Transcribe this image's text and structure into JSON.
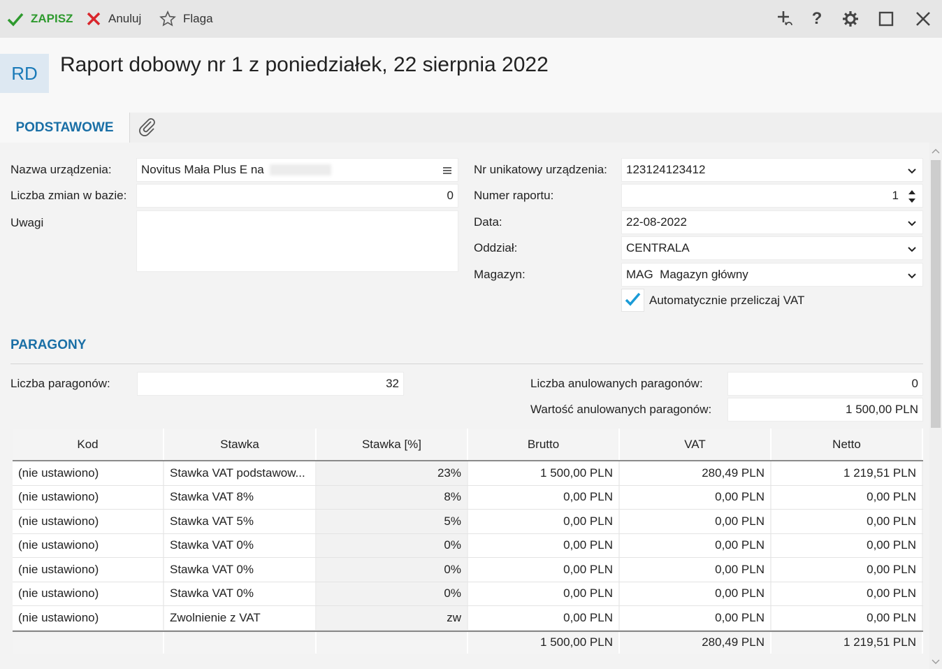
{
  "toolbar": {
    "save_label": "ZAPISZ",
    "cancel_label": "Anuluj",
    "flag_label": "Flaga",
    "help_label": "?",
    "save_color": "#2e9a2e",
    "cancel_color": "#d9262c"
  },
  "header": {
    "badge": "RD",
    "title": "Raport dobowy nr 1 z poniedziałek, 22 sierpnia 2022"
  },
  "tabs": {
    "active": "PODSTAWOWE"
  },
  "form": {
    "device_name_label": "Nazwa urządzenia:",
    "device_name_value": "Novitus Mała Plus E na",
    "shift_count_label": "Liczba zmian w bazie:",
    "shift_count_value": "0",
    "notes_label": "Uwagi",
    "notes_value": "",
    "unique_no_label": "Nr unikatowy urządzenia:",
    "unique_no_value": "123124123412",
    "report_no_label": "Numer raportu:",
    "report_no_value": "1",
    "date_label": "Data:",
    "date_value": "22-08-2022",
    "branch_label": "Oddział:",
    "branch_value": "CENTRALA",
    "warehouse_label": "Magazyn:",
    "warehouse_value": "MAG  Magazyn główny",
    "auto_vat_label": "Automatycznie przeliczaj VAT",
    "auto_vat_checked": true
  },
  "receipts": {
    "section_title": "PARAGONY",
    "count_label": "Liczba paragonów:",
    "count_value": "32",
    "cancelled_count_label": "Liczba anulowanych paragonów:",
    "cancelled_count_value": "0",
    "cancelled_value_label": "Wartość anulowanych paragonów:",
    "cancelled_value_value": "1 500,00 PLN"
  },
  "table": {
    "headers": [
      "Kod",
      "Stawka",
      "Stawka [%]",
      "Brutto",
      "VAT",
      "Netto"
    ],
    "rows": [
      [
        "(nie ustawiono)",
        "Stawka VAT podstawow...",
        "23%",
        "1 500,00 PLN",
        "280,49 PLN",
        "1 219,51 PLN"
      ],
      [
        "(nie ustawiono)",
        "Stawka VAT 8%",
        "8%",
        "0,00 PLN",
        "0,00 PLN",
        "0,00 PLN"
      ],
      [
        "(nie ustawiono)",
        "Stawka VAT 5%",
        "5%",
        "0,00 PLN",
        "0,00 PLN",
        "0,00 PLN"
      ],
      [
        "(nie ustawiono)",
        "Stawka VAT 0%",
        "0%",
        "0,00 PLN",
        "0,00 PLN",
        "0,00 PLN"
      ],
      [
        "(nie ustawiono)",
        "Stawka VAT 0%",
        "0%",
        "0,00 PLN",
        "0,00 PLN",
        "0,00 PLN"
      ],
      [
        "(nie ustawiono)",
        "Stawka VAT 0%",
        "0%",
        "0,00 PLN",
        "0,00 PLN",
        "0,00 PLN"
      ],
      [
        "(nie ustawiono)",
        "Zwolnienie z VAT",
        "zw",
        "0,00 PLN",
        "0,00 PLN",
        "0,00 PLN"
      ]
    ],
    "totals": [
      "",
      "",
      "",
      "1 500,00 PLN",
      "280,49 PLN",
      "1 219,51 PLN"
    ]
  },
  "icons": {
    "save": "check-icon",
    "cancel": "x-icon",
    "flag": "star-outline-icon",
    "add_related": "plus-link-icon",
    "help": "question-icon",
    "settings": "gear-icon",
    "maximize": "maximize-icon",
    "close": "close-icon",
    "attachment": "paperclip-icon",
    "menu": "hamburger-icon",
    "dropdown": "chevron-down-icon",
    "spinner": "spinner-arrows-icon"
  }
}
